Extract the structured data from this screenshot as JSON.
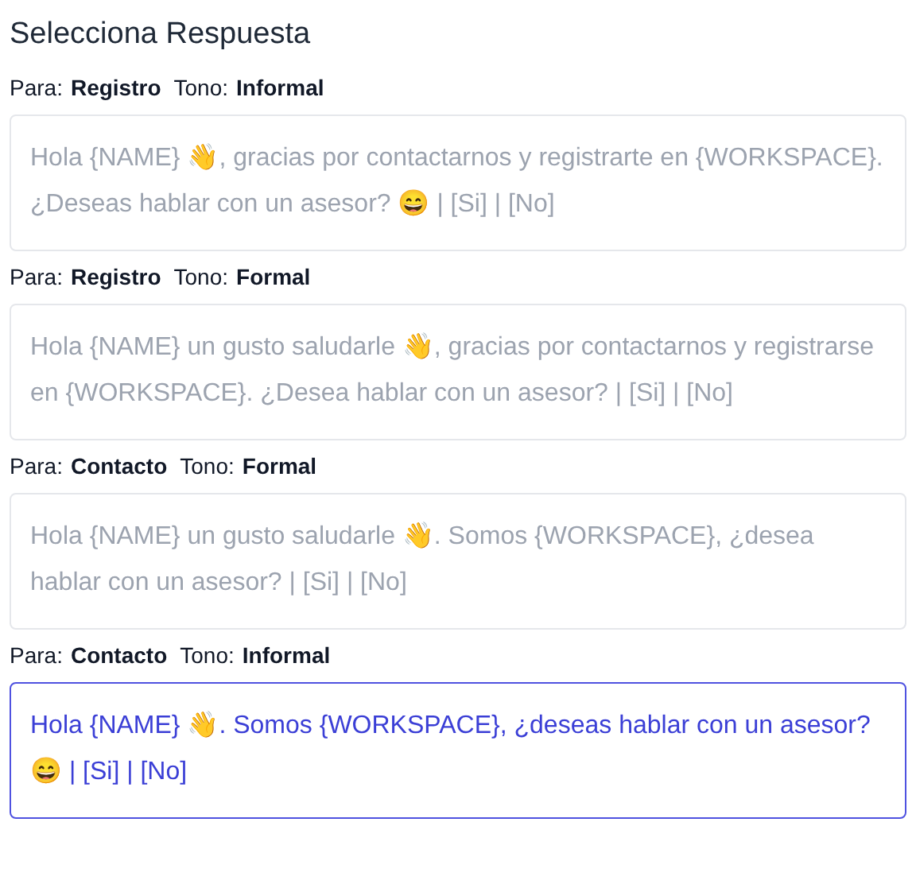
{
  "title": "Selecciona Respuesta",
  "options": [
    {
      "para_label": "Para:",
      "para": "Registro",
      "tono_label": "Tono:",
      "tono": "Informal",
      "message": "Hola {NAME} 👋, gracias por contactarnos y registrarte en {WORKSPACE}. ¿Deseas hablar con un asesor? 😄 | [Si] | [No]",
      "selected": false
    },
    {
      "para_label": "Para:",
      "para": "Registro",
      "tono_label": "Tono:",
      "tono": "Formal",
      "message": "Hola {NAME} un gusto saludarle 👋, gracias por contactarnos y registrarse en {WORKSPACE}. ¿Desea hablar con un asesor? | [Si] | [No]",
      "selected": false
    },
    {
      "para_label": "Para:",
      "para": "Contacto",
      "tono_label": "Tono:",
      "tono": "Formal",
      "message": "Hola {NAME} un gusto saludarle 👋. Somos {WORKSPACE}, ¿desea hablar con un asesor? | [Si] | [No]",
      "selected": false
    },
    {
      "para_label": "Para:",
      "para": "Contacto",
      "tono_label": "Tono:",
      "tono": "Informal",
      "message": "Hola {NAME} 👋. Somos {WORKSPACE}, ¿deseas hablar con un asesor? 😄 | [Si] | [No]",
      "selected": true
    }
  ]
}
